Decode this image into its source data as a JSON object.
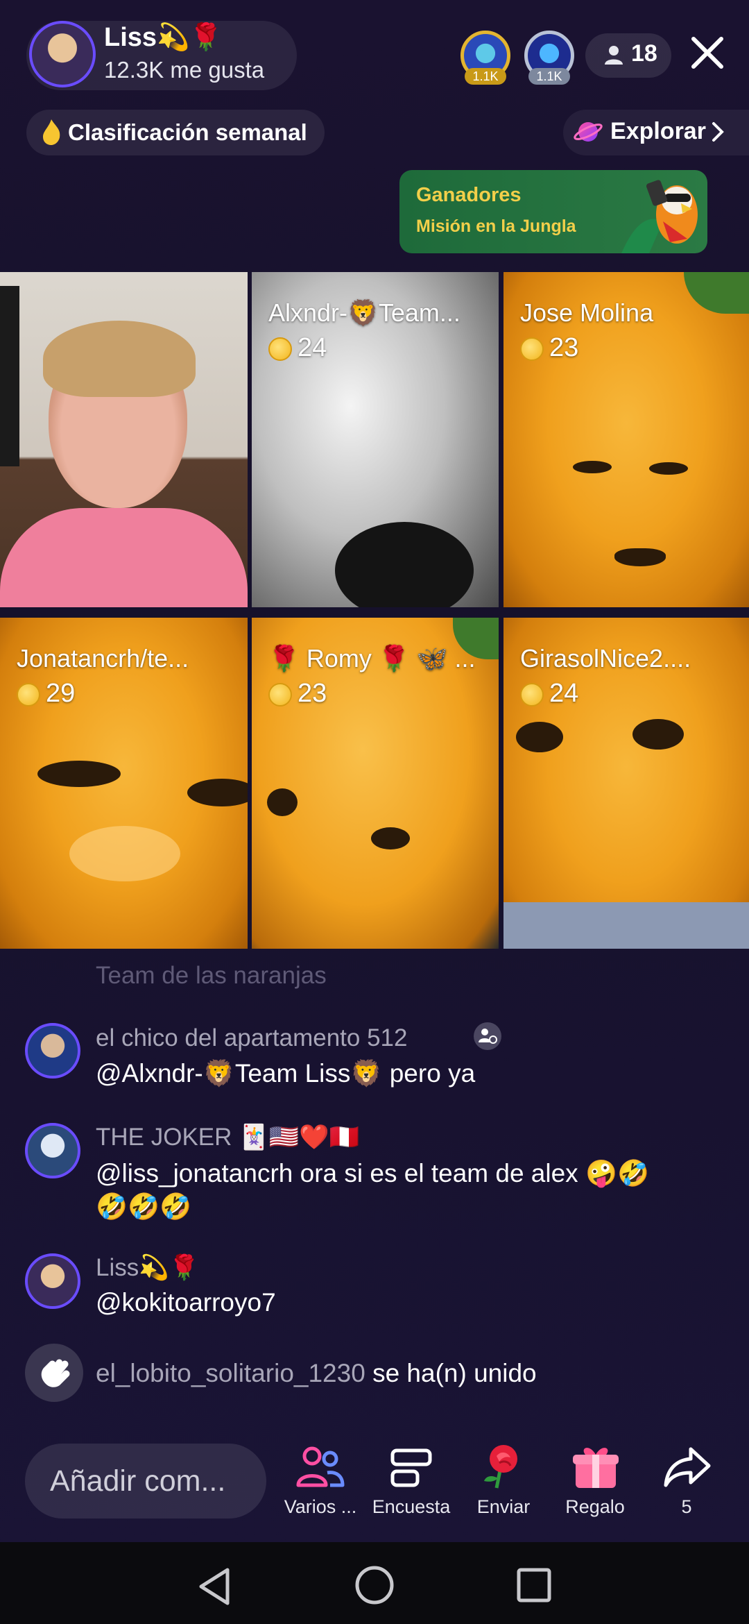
{
  "header": {
    "host_name": "Liss💫🌹",
    "likes": "12.3K me gusta",
    "top_viewers": [
      {
        "badge": "1.1K",
        "color": "#e3b530"
      },
      {
        "badge": "1.1K",
        "color": "#b9c2d6"
      }
    ],
    "viewer_count": "18"
  },
  "subheader": {
    "weekly_label": "Clasificación semanal",
    "explore_label": "Explorar"
  },
  "banner": {
    "title": "Ganadores",
    "subtitle": "Misión en la Jungla"
  },
  "grid": [
    {
      "name": "",
      "score": ""
    },
    {
      "name": "Alxndr-🦁Team...",
      "score": "24"
    },
    {
      "name": "Jose Molina",
      "score": "23"
    },
    {
      "name": "Jonatancrh/te...",
      "score": "29"
    },
    {
      "name": "🌹 Romy 🌹 🦋 ...",
      "score": "23"
    },
    {
      "name": "GirasolNice2....",
      "score": "24"
    }
  ],
  "comments": {
    "faded": "Team de las naranjas",
    "items": [
      {
        "user": "el chico del apartamento 512",
        "text": "@Alxndr-🦁Team Liss🦁 pero ya"
      },
      {
        "user": "THE JOKER 🃏🇺🇸❤️🇵🇪",
        "text": "@liss_jonatancrh ora  si es el team de alex 🤪🤣",
        "text2": "🤣🤣🤣"
      },
      {
        "user": "Liss💫🌹",
        "text": "@kokitoarroyo7"
      }
    ],
    "join": {
      "user": "el_lobito_solitario_1230",
      "action": "se ha(n) unido"
    }
  },
  "bottom": {
    "input_placeholder": "Añadir com...",
    "tools": [
      {
        "label": "Varios ...",
        "icon": "multi-guest-icon"
      },
      {
        "label": "Encuesta",
        "icon": "poll-icon"
      },
      {
        "label": "Enviar",
        "icon": "rose-icon"
      },
      {
        "label": "Regalo",
        "icon": "gift-icon"
      },
      {
        "label": "5",
        "icon": "share-icon"
      }
    ]
  },
  "colors": {
    "accent": "#fe2c55",
    "coin": "#f3b51d",
    "banner_text": "#f2cf4a"
  }
}
